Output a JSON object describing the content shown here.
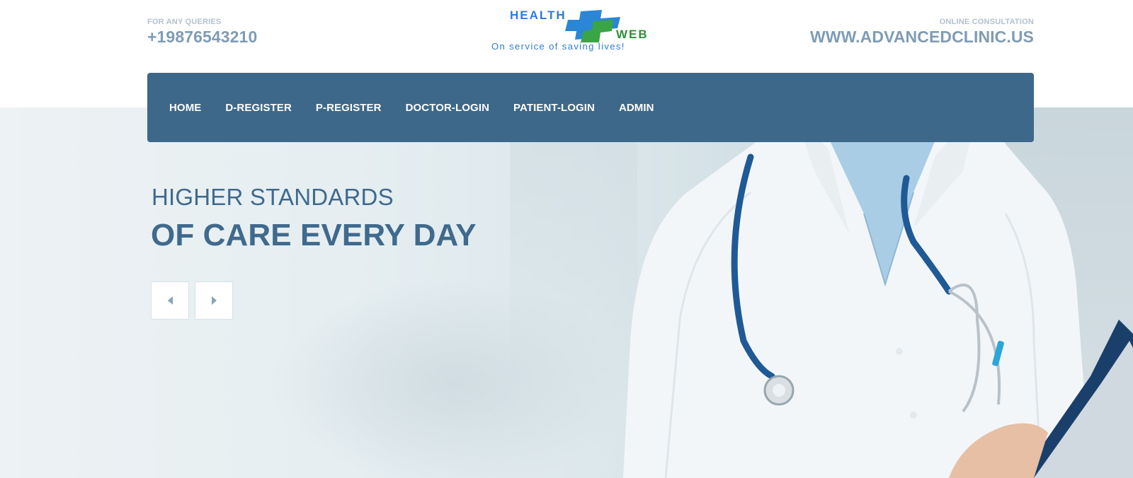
{
  "header": {
    "left": {
      "label": "FOR ANY QUERIES",
      "value": "+19876543210"
    },
    "right": {
      "label": "ONLINE CONSULTATION",
      "value": "WWW.ADVANCEDCLINIC.US"
    },
    "logo": {
      "word1": "HEALTH",
      "word2": "WEB",
      "tagline": "On service of saving lives!"
    }
  },
  "nav": {
    "items": [
      "HOME",
      "D-REGISTER",
      "P-REGISTER",
      "DOCTOR-LOGIN",
      "PATIENT-LOGIN",
      "ADMIN"
    ]
  },
  "hero": {
    "line1": "HIGHER STANDARDS",
    "line2": "OF CARE EVERY DAY",
    "prev_icon": "caret-left-icon",
    "next_icon": "caret-right-icon"
  },
  "colors": {
    "nav_bg": "#3e688a",
    "headline": "#3f6a8e",
    "contact_value": "#7f9cb5",
    "contact_label": "#b3c2cf"
  }
}
